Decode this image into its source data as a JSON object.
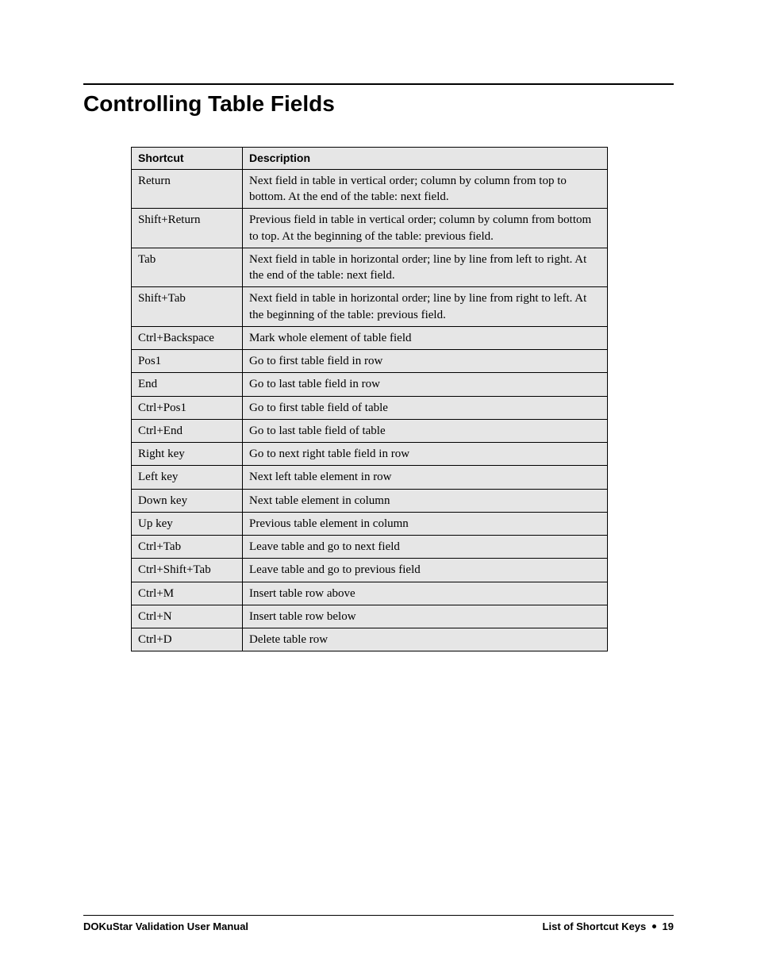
{
  "section_title": "Controlling Table Fields",
  "table": {
    "headers": {
      "shortcut": "Shortcut",
      "description": "Description"
    },
    "rows": [
      {
        "shortcut": "Return",
        "description": "Next field in table in vertical order; column by column from top to bottom. At the end of the table: next field."
      },
      {
        "shortcut": "Shift+Return",
        "description": "Previous field in table in vertical order; column by column from bottom to top. At the beginning of the table: previous field."
      },
      {
        "shortcut": "Tab",
        "description": "Next field in table in horizontal order; line by line from left to right. At the end of the table: next field."
      },
      {
        "shortcut": "Shift+Tab",
        "description": "Next field in table in horizontal order; line by line from right to left. At the beginning of the table: previous field."
      },
      {
        "shortcut": "Ctrl+Backspace",
        "description": "Mark whole element of table field"
      },
      {
        "shortcut": "Pos1",
        "description": "Go to first table field in row"
      },
      {
        "shortcut": "End",
        "description": "Go to last table field in row"
      },
      {
        "shortcut": "Ctrl+Pos1",
        "description": "Go to first table field of table"
      },
      {
        "shortcut": "Ctrl+End",
        "description": "Go to last table field of table"
      },
      {
        "shortcut": "Right key",
        "description": "Go to next right table field in row"
      },
      {
        "shortcut": "Left key",
        "description": "Next left table element in row"
      },
      {
        "shortcut": "Down key",
        "description": "Next table element in column"
      },
      {
        "shortcut": "Up key",
        "description": "Previous table element in column"
      },
      {
        "shortcut": "Ctrl+Tab",
        "description": "Leave table and go to next field"
      },
      {
        "shortcut": "Ctrl+Shift+Tab",
        "description": "Leave table and go to previous field"
      },
      {
        "shortcut": "Ctrl+M",
        "description": "Insert table row above"
      },
      {
        "shortcut": "Ctrl+N",
        "description": "Insert table row below"
      },
      {
        "shortcut": "Ctrl+D",
        "description": "Delete table row"
      }
    ]
  },
  "footer": {
    "left": "DOKuStar Validation User Manual",
    "right_label": "List of Shortcut Keys",
    "page_number": "19"
  }
}
